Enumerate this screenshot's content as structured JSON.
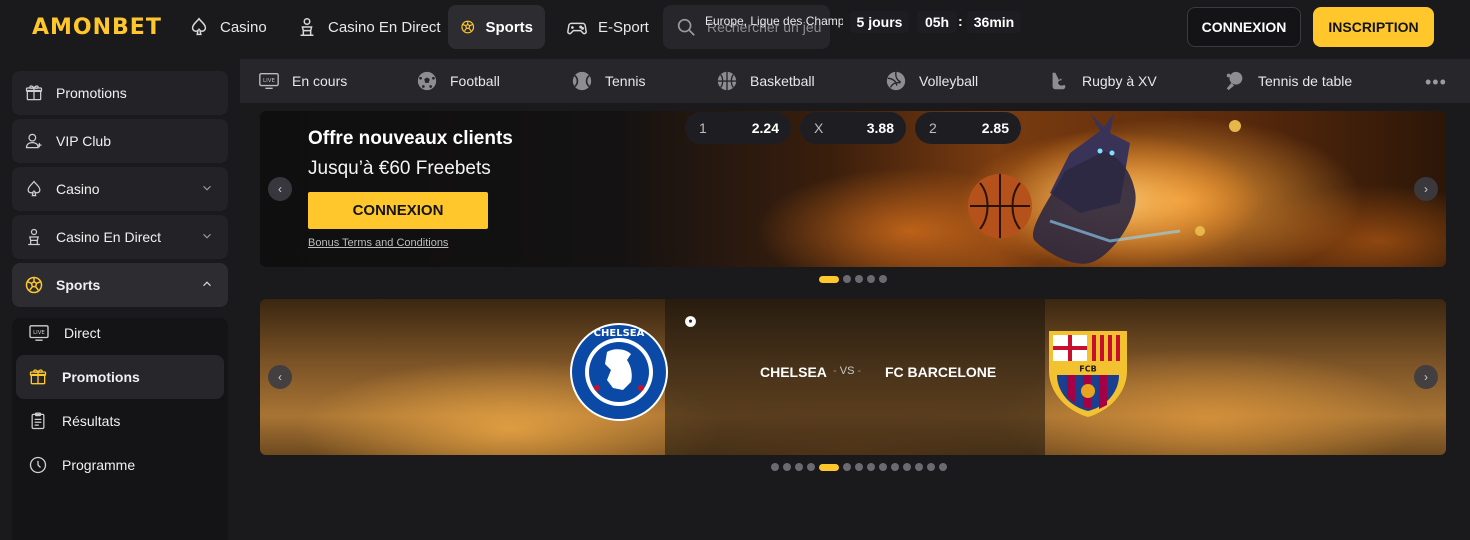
{
  "header": {
    "logo": "AMONBET",
    "nav": [
      {
        "label": "Casino",
        "icon": "spade-icon"
      },
      {
        "label": "Casino En Direct",
        "icon": "dealer-icon"
      },
      {
        "label": "Sports",
        "icon": "soccer-ball-icon",
        "active": true
      },
      {
        "label": "E-Sport",
        "icon": "gamepad-icon"
      }
    ],
    "search_placeholder": "Rechercher un jeu",
    "login_label": "CONNEXION",
    "signup_label": "INSCRIPTION"
  },
  "sidebar": {
    "items": [
      {
        "label": "Promotions",
        "icon": "gift-icon"
      },
      {
        "label": "VIP Club",
        "icon": "user-icon"
      },
      {
        "label": "Casino",
        "icon": "spade-icon",
        "chevron": "down"
      },
      {
        "label": "Casino En Direct",
        "icon": "dealer-icon",
        "chevron": "down"
      },
      {
        "label": "Sports",
        "icon": "soccer-ball-icon",
        "chevron": "up"
      }
    ],
    "sub_items": [
      {
        "label": "Direct",
        "icon": "live-icon"
      },
      {
        "label": "Promotions",
        "icon": "gift-icon",
        "active": true
      },
      {
        "label": "Résultats",
        "icon": "clipboard-icon"
      },
      {
        "label": "Programme",
        "icon": "clock-icon"
      }
    ]
  },
  "sports_bar": {
    "items": [
      {
        "label": "En cours",
        "icon": "live-icon"
      },
      {
        "label": "Football",
        "icon": "soccer-ball-icon"
      },
      {
        "label": "Tennis",
        "icon": "tennis-ball-icon"
      },
      {
        "label": "Basketball",
        "icon": "basketball-icon"
      },
      {
        "label": "Volleyball",
        "icon": "volleyball-icon"
      },
      {
        "label": "Rugby à XV",
        "icon": "rugby-icon"
      },
      {
        "label": "Tennis de table",
        "icon": "table-tennis-icon"
      }
    ],
    "more": "•••"
  },
  "promo_banner": {
    "title": "Offre nouveaux clients",
    "subtitle": "Jusqu’à €60 Freebets",
    "button": "CONNEXION",
    "terms": "Bonus Terms and Conditions",
    "prev": "‹",
    "next": "›",
    "dots": 5,
    "active_dot": 0
  },
  "match_banner": {
    "league": "Europe, Ligue des Champions",
    "timer": {
      "days": "5 jours",
      "hours": "05h",
      "separator": ":",
      "minutes": "36min"
    },
    "home": "CHELSEA",
    "away": "FC BARCELONE",
    "vs": "VS",
    "odds": [
      {
        "label": "1",
        "value": "2.24"
      },
      {
        "label": "X",
        "value": "3.88"
      },
      {
        "label": "2",
        "value": "2.85"
      }
    ],
    "prev": "‹",
    "next": "›",
    "dots": 14,
    "active_dot": 4
  },
  "colors": {
    "accent": "#ffc72c",
    "background": "#1a1a1d",
    "panel": "#26262b"
  }
}
